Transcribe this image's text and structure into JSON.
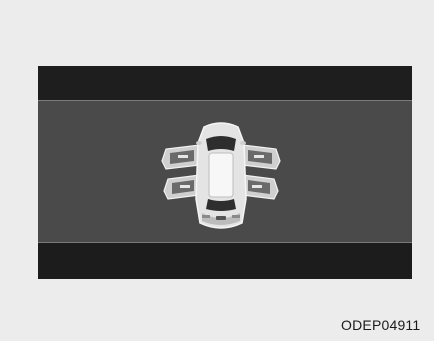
{
  "figure": {
    "code_label": "ODEP04911",
    "icon": "car-open-doors-icon",
    "colors": {
      "page_bg": "#ececec",
      "screen_dark": "#1c1c1c",
      "screen_mid": "#4a4a4a",
      "car_body": "#d9d9d9"
    }
  }
}
